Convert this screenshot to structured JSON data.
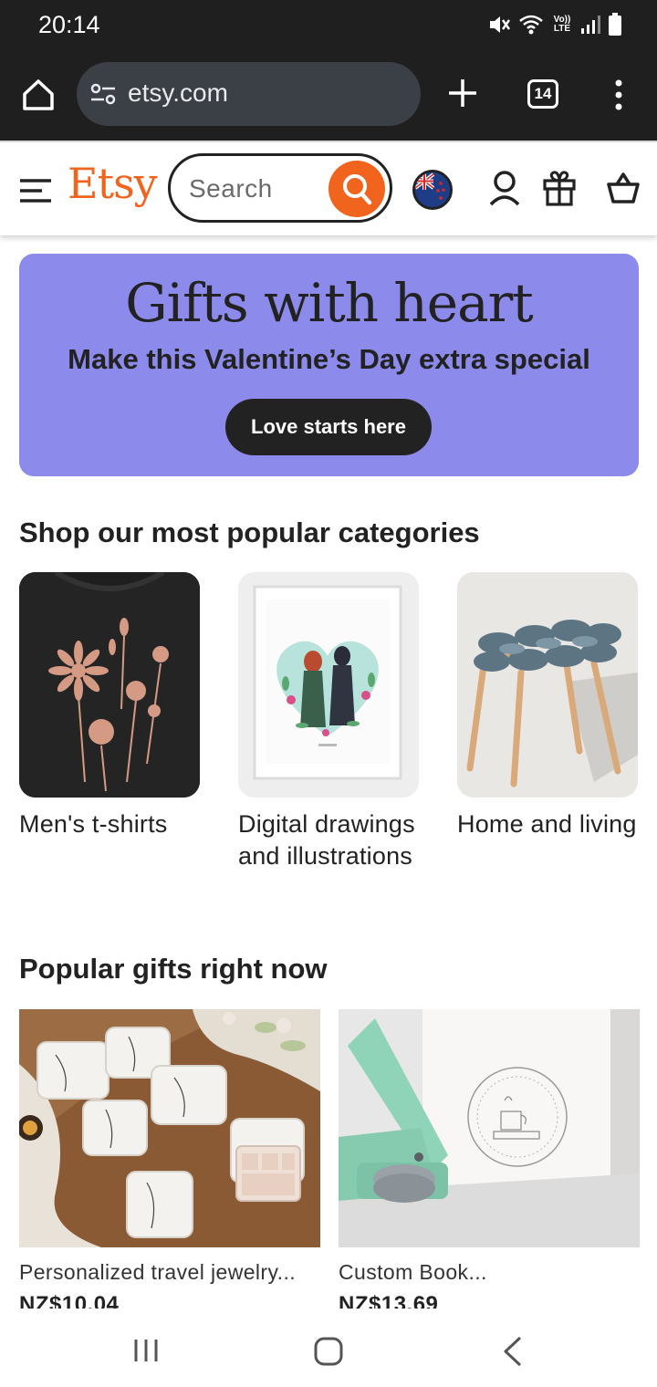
{
  "status_bar": {
    "time": "20:14",
    "icons": [
      "mute-icon",
      "wifi-icon",
      "volte-icon",
      "signal-icon",
      "battery-icon"
    ],
    "volte_label": "Vo)) LTE"
  },
  "browser": {
    "url": "etsy.com",
    "tab_count": "14",
    "icons": [
      "home-icon",
      "site-settings-icon",
      "plus-icon",
      "more-vert-icon"
    ]
  },
  "header": {
    "logo": "Etsy",
    "search_placeholder": "Search",
    "icons": [
      "menu-icon",
      "search-icon",
      "nz-flag-icon",
      "account-icon",
      "gift-icon",
      "cart-icon"
    ],
    "brand_color": "#f1641e"
  },
  "hero": {
    "title": "Gifts with heart",
    "subtitle": "Make this Valentine’s Day extra special",
    "cta": "Love starts here",
    "background": "#8c8aea"
  },
  "categories": {
    "title": "Shop our most popular categories",
    "items": [
      {
        "label": "Men's t-shirts",
        "image": "floral-tshirt-image"
      },
      {
        "label": "Digital drawings and illustrations",
        "image": "couple-heart-illustration-image"
      },
      {
        "label": "Home and living",
        "image": "woven-stool-image"
      }
    ]
  },
  "gifts": {
    "title": "Popular gifts right now",
    "items": [
      {
        "title": "Personalized travel jewelry...",
        "price": "NZ$10.04",
        "image": "jewelry-boxes-image"
      },
      {
        "title": "Custom Book...",
        "price": "NZ$13.69",
        "image": "book-embosser-image"
      }
    ]
  },
  "nav": {
    "icons": [
      "recent-apps-icon",
      "home-button-icon",
      "back-icon"
    ]
  }
}
